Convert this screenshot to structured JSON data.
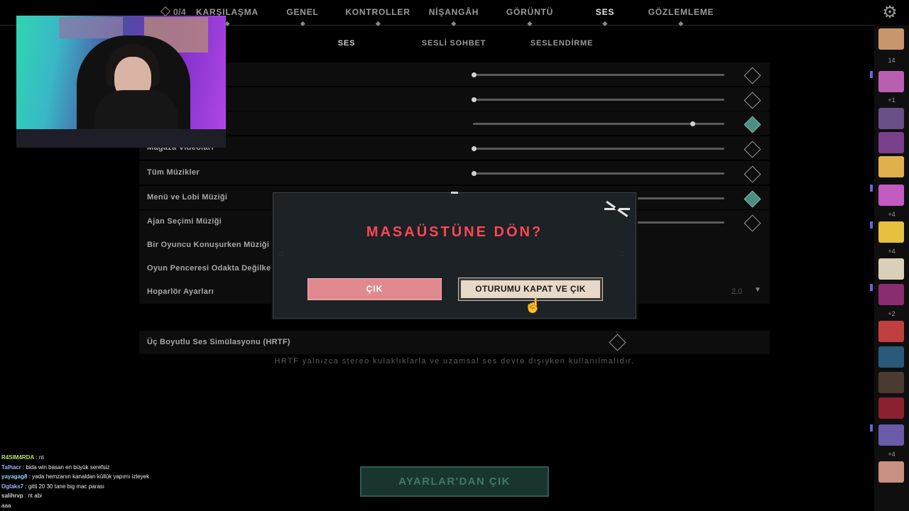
{
  "top_nav": {
    "counter": "0/4",
    "tabs": [
      "KARŞILAŞMA",
      "GENEL",
      "KONTROLLER",
      "NİŞANGÂH",
      "GÖRÜNTÜ",
      "SES",
      "GÖZLEMLEME"
    ],
    "active_tab": "SES",
    "settings_icon": "gear-icon"
  },
  "sub_nav": {
    "tabs": [
      "SES",
      "SESLİ SOHBET",
      "SESLENDİRME"
    ],
    "active_tab": "SES"
  },
  "settings": {
    "rows": [
      {
        "label": "",
        "type": "slider",
        "value": 0.0
      },
      {
        "label": "",
        "type": "slider",
        "value": 0.0
      },
      {
        "label": "",
        "type": "slider",
        "value": 0.87
      },
      {
        "label": "Mağaza Videoları",
        "type": "slider",
        "value": 0.0
      },
      {
        "label": "Tüm Müzikler",
        "type": "slider",
        "value": 0.0
      },
      {
        "label": "Menü ve Lobi Müziği",
        "type": "slider",
        "value": 0.0
      },
      {
        "label": "Ajan Seçimi Müziği",
        "type": "slider",
        "value": 0.0
      },
      {
        "label": "Bir Oyuncu Konuşurken Müziği",
        "type": "toggle"
      },
      {
        "label": "Oyun Penceresi Odakta Değilke",
        "type": "toggle"
      },
      {
        "label": "Hoparlör Ayarları",
        "type": "dropdown",
        "value": "2.0"
      }
    ],
    "hrtf_label": "Üç Boyutlu Ses Simülasyonu (HRTF)",
    "hrtf_note": "HRTF yalnızca stereo kulaklıklarla ve uzamsal ses devre dışıyken kullanılmalıdır.",
    "exit_button": "AYARLAR'DAN ÇIK"
  },
  "modal": {
    "title": "MASAÜSTÜNE DÖN?",
    "quit_button": "ÇIK",
    "logout_button": "OTURUMU KAPAT VE ÇIK",
    "close_icon": "close-icon"
  },
  "right_rail": {
    "counts": [
      "14",
      "+1",
      "+4",
      "+4",
      "+2",
      "+4"
    ],
    "avatar_colors": [
      "#c8966c",
      "#b85fb0",
      "#6a4f88",
      "#7a3f8a",
      "#e0b04c",
      "#c25ac0",
      "#e8c040",
      "#d8d0b8",
      "#8a2c70",
      "#c04040",
      "#2a5a7a",
      "#4a3a30",
      "#8a2030",
      "#6a5aa8",
      "#c89080"
    ]
  },
  "chat": [
    {
      "user": "R4SIM4RDA",
      "text": "nt",
      "color": "#b7e36a"
    },
    {
      "user": "Talhacr",
      "text": "bida win basan en büyük serefsiz",
      "color": "#a0b4ff"
    },
    {
      "user": "yayagag8",
      "text": "yada hemzanın kanaldan küllük yapımı izleyek",
      "color": "#8fd1ff"
    },
    {
      "user": "Oglaks7",
      "text": "gitti 20 30 tane big mac parası",
      "color": "#a0b4ff"
    },
    {
      "user": "salihrvp",
      "text": "nt abi",
      "color": "#d0d0d0"
    },
    {
      "user": "",
      "text": "aaa",
      "color": "#d0d0d0"
    }
  ]
}
